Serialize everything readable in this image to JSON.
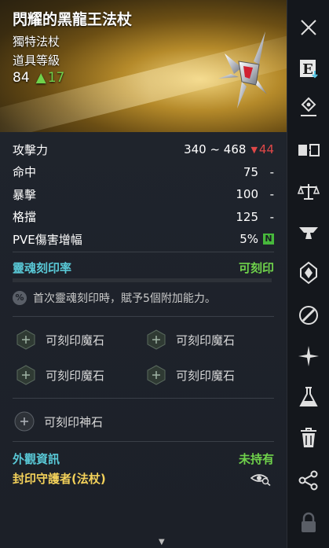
{
  "item": {
    "title": "閃耀的黑龍王法杖",
    "subtitle": "獨特法杖",
    "level_label": "道具等級",
    "level": "84",
    "level_arrow": "▲",
    "level_bonus": "17"
  },
  "stats": [
    {
      "name": "攻擊力",
      "value": "340 ~ 468",
      "change_arrow": "▼",
      "change": "44"
    },
    {
      "name": "命中",
      "value": "75",
      "suffix": "-"
    },
    {
      "name": "暴擊",
      "value": "100",
      "suffix": "-"
    },
    {
      "name": "格擋",
      "value": "125",
      "suffix": "-"
    },
    {
      "name": "PVE傷害增幅",
      "value": "5%",
      "badge": "N"
    }
  ],
  "soul": {
    "label": "靈魂刻印率",
    "state": "可刻印",
    "info_icon": "%",
    "info": "首次靈魂刻印時，賦予5個附加能力。"
  },
  "slots": {
    "magic": [
      "可刻印魔石",
      "可刻印魔石",
      "可刻印魔石",
      "可刻印魔石"
    ],
    "god": "可刻印神石"
  },
  "appearance": {
    "label": "外觀資訊",
    "state": "未持有",
    "seal": "封印守護者(法杖)"
  },
  "sidebar": {
    "close": "close-icon",
    "equip_letter": "E",
    "icons": [
      "equip-icon",
      "location-pin-icon",
      "compare-icon",
      "scale-icon",
      "anvil-icon",
      "soul-crystal-icon",
      "ring-icon",
      "sparkle-icon",
      "flask-icon",
      "trash-icon",
      "share-icon",
      "lock-icon"
    ]
  },
  "colors": {
    "accent_cyan": "#59c8d6",
    "positive_green": "#6fd24b",
    "negative_red": "#e04848",
    "seal_yellow": "#f3d15a"
  }
}
